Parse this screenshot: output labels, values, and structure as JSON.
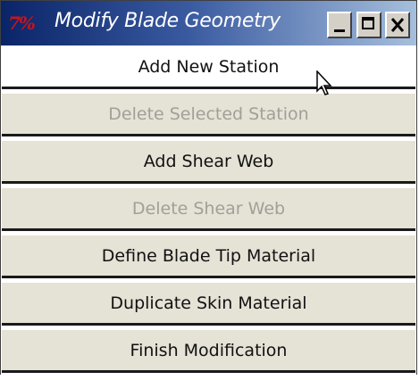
{
  "window": {
    "app_icon_text": "7%",
    "title": "Modify Blade Geometry",
    "icons": [
      "minimize-icon",
      "maximize-icon",
      "close-icon",
      "mouse-pointer-icon"
    ]
  },
  "menu": {
    "items": [
      {
        "label": "Add New Station",
        "enabled": true
      },
      {
        "label": "Delete Selected Station",
        "enabled": false
      },
      {
        "label": "Add Shear Web",
        "enabled": true
      },
      {
        "label": "Delete Shear Web",
        "enabled": false
      },
      {
        "label": "Define Blade Tip Material",
        "enabled": true
      },
      {
        "label": "Duplicate Skin Material",
        "enabled": true
      },
      {
        "label": "Finish Modification",
        "enabled": true
      }
    ]
  },
  "colors": {
    "title_start": "#0a2468",
    "title_end": "#a6bfdd",
    "button_face": "#e5e2d6",
    "disabled_text": "#a29f98"
  }
}
